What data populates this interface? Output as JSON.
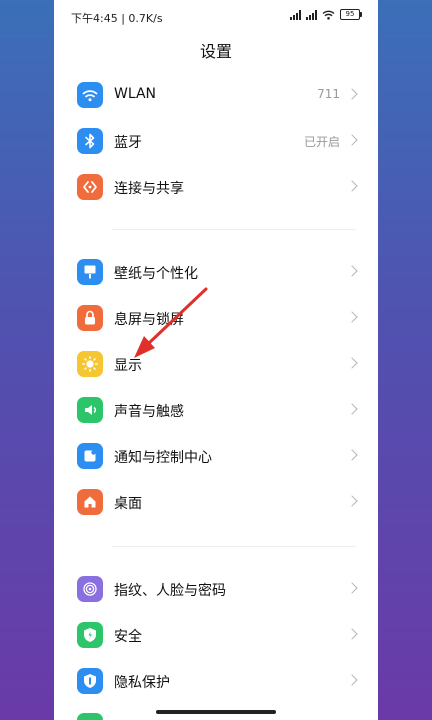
{
  "status": {
    "time_speed": "下午4:45 | 0.7K/s",
    "battery": "95"
  },
  "title": "设置",
  "groups": [
    [
      {
        "label": "WLAN",
        "value": "711",
        "icon": "wifi-icon",
        "color": "#2b8ef0"
      },
      {
        "label": "蓝牙",
        "value": "已开启",
        "icon": "bluetooth-icon",
        "color": "#2b8ef0"
      },
      {
        "label": "连接与共享",
        "value": "",
        "icon": "share-icon",
        "color": "#f06c3c"
      }
    ],
    [
      {
        "label": "壁纸与个性化",
        "value": "",
        "icon": "wallpaper-icon",
        "color": "#2b8ef0"
      },
      {
        "label": "息屏与锁屏",
        "value": "",
        "icon": "lock-icon",
        "color": "#f06c3c"
      },
      {
        "label": "显示",
        "value": "",
        "icon": "sun-icon",
        "color": "#f5c532"
      },
      {
        "label": "声音与触感",
        "value": "",
        "icon": "speaker-icon",
        "color": "#2cc56a"
      },
      {
        "label": "通知与控制中心",
        "value": "",
        "icon": "notification-icon",
        "color": "#2b8ef0"
      },
      {
        "label": "桌面",
        "value": "",
        "icon": "home-icon",
        "color": "#f06c3c"
      }
    ],
    [
      {
        "label": "指纹、人脸与密码",
        "value": "",
        "icon": "fingerprint-icon",
        "color": "#8a6fe0"
      },
      {
        "label": "安全",
        "value": "",
        "icon": "shield-icon",
        "color": "#2cc56a"
      },
      {
        "label": "隐私保护",
        "value": "",
        "icon": "privacy-icon",
        "color": "#2b8ef0"
      }
    ]
  ],
  "annotation_color": "#e0302a"
}
